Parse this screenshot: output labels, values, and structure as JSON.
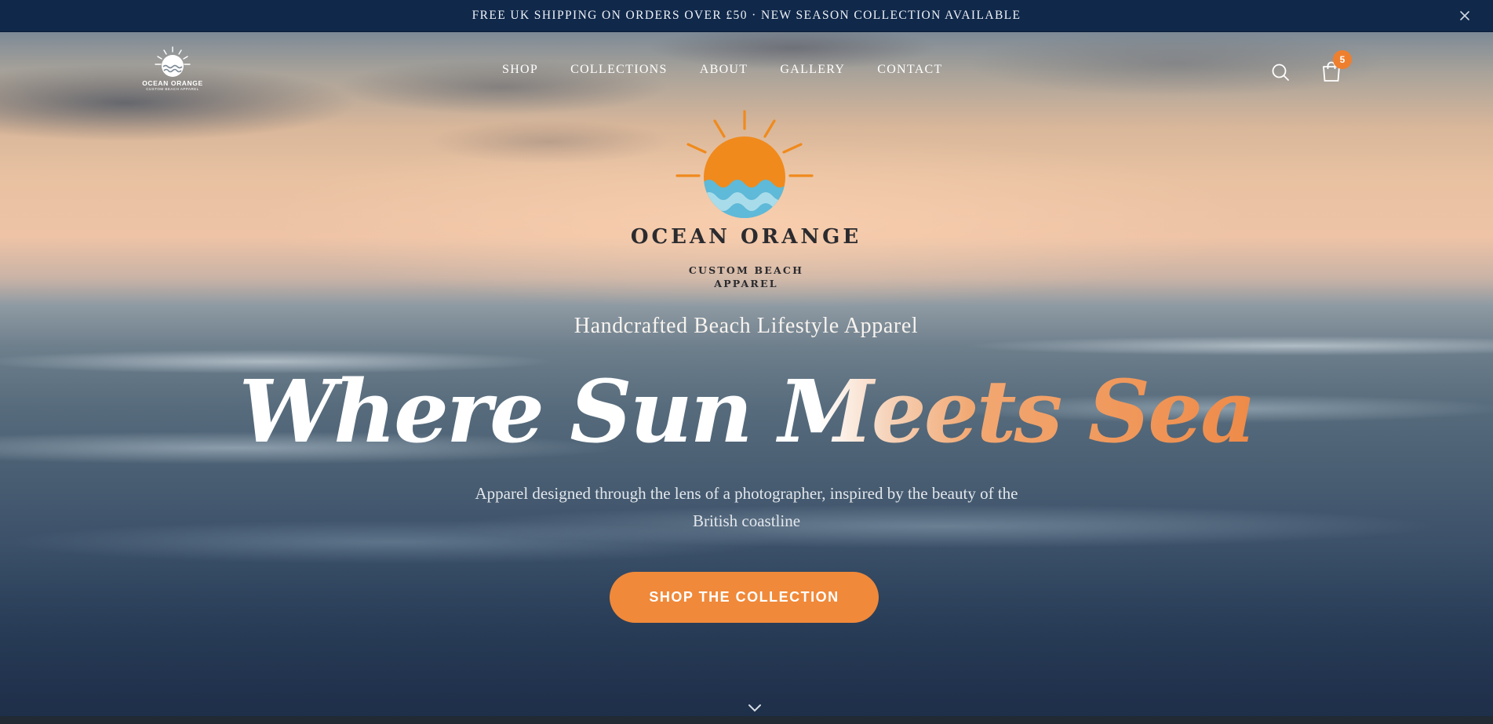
{
  "announcement": {
    "text": "FREE UK SHIPPING ON ORDERS OVER £50 · NEW SEASON COLLECTION AVAILABLE",
    "close_icon": "close-icon"
  },
  "header": {
    "logo": {
      "name": "OCEAN ORANGE",
      "sub": "CUSTOM BEACH APPAREL"
    },
    "nav": [
      {
        "label": "SHOP"
      },
      {
        "label": "COLLECTIONS"
      },
      {
        "label": "ABOUT"
      },
      {
        "label": "GALLERY"
      },
      {
        "label": "CONTACT"
      }
    ],
    "search_icon": "search-icon",
    "cart_icon": "shopping-bag-icon",
    "cart_count": "5"
  },
  "hero": {
    "brand_name": "OCEAN ORANGE",
    "brand_sub_line1": "CUSTOM BEACH",
    "brand_sub_line2": "APPAREL",
    "tagline": "Handcrafted Beach Lifestyle Apparel",
    "headline": "Where Sun Meets Sea",
    "description": "Apparel designed through the lens of a photographer, inspired by the beauty of the British coastline",
    "cta_label": "SHOP THE COLLECTION",
    "scroll_icon": "chevron-down-icon"
  },
  "colors": {
    "announcement_bg": "#10284a",
    "accent_orange": "#f0893a",
    "badge_orange": "#ee7f2f",
    "sun_orange": "#f08a1c",
    "wave_blue": "#5fb9d8",
    "brand_text": "#2b2b2f"
  }
}
